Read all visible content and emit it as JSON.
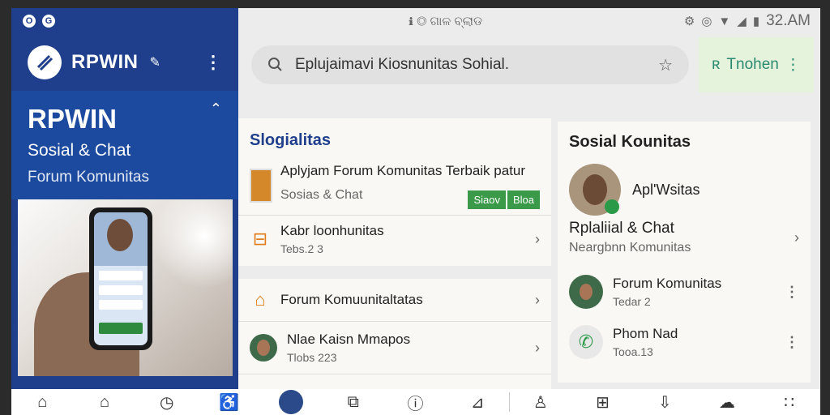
{
  "status": {
    "left_icons": [
      "o-icon",
      "g-icon"
    ],
    "center_text": "ℹ ◎ ଗାଳ ବ୍ଲାଡ",
    "time": "32.AM"
  },
  "sidebar": {
    "app_name": "RPWIN",
    "hero_title": "RPWIN",
    "hero_subtitle": "Sosial & Chat",
    "hero_forum": "Forum Komunitas"
  },
  "search": {
    "query": "Eplujaimavi Kiosnunitas Sohial."
  },
  "trend": {
    "label": "Tnohen"
  },
  "card_left": {
    "header": "Slogialitas",
    "items": [
      {
        "title": "Aplyjam Forum Komunitas Terbaik patur",
        "subtitle": "Sosias & Chat",
        "badges": [
          "Siaov",
          "Bloa"
        ]
      },
      {
        "title": "Kabr loonhunitas",
        "subtitle": "Tebs.2 3"
      }
    ]
  },
  "card_left2": {
    "items": [
      {
        "title": "Forum Komuunitaltatas"
      },
      {
        "title": "Nlae Kaisn Mmapos",
        "subtitle": "Tlobs 223"
      }
    ]
  },
  "card_right": {
    "header": "Sosial Kounitas",
    "profile_name": "Apl'Wsitas",
    "title": "Rplaliial & Chat",
    "subtitle": "Neargbnn Komunitas",
    "items": [
      {
        "title": "Forum Komunitas",
        "subtitle": "Tedar 2"
      },
      {
        "title": "Phom Nad",
        "subtitle": "Tooa.13"
      }
    ]
  },
  "bottom_nav": {
    "items": [
      "home-icon",
      "home-alt-icon",
      "clock-icon",
      "accessibility-icon",
      "avatar",
      "share-icon",
      "info-icon",
      "folder-icon",
      "person-icon",
      "grid-icon",
      "download-icon",
      "cloud-icon",
      "more-grid-icon"
    ]
  }
}
